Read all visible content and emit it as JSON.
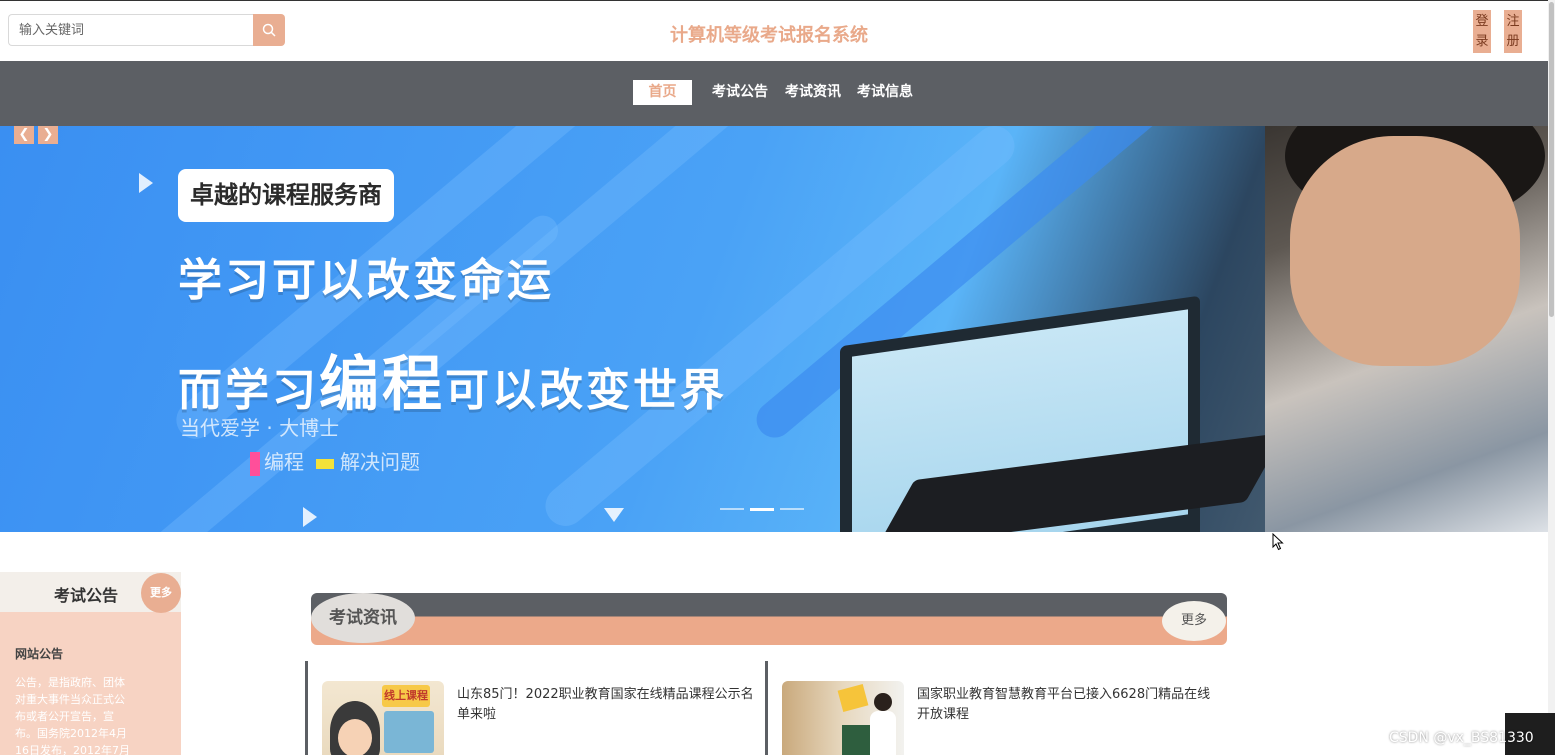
{
  "header": {
    "search_placeholder": "输入关键词",
    "title": "计算机等级考试报名系统",
    "login_label": "登录",
    "register_label": "注册"
  },
  "nav": {
    "items": [
      "首页",
      "考试公告",
      "考试资讯",
      "考试信息"
    ],
    "active_index": 0
  },
  "banner": {
    "badge": "卓越的课程服务商",
    "headline1": "学习可以改变命运",
    "headline2_pre": "而学习",
    "headline2_big": "编程",
    "headline2_post": "可以改变世界",
    "subtitle": "当代爱学 · 大博士",
    "tag1": "编程",
    "tag2": "解决问题",
    "prev_icon": "chevron-left-icon",
    "next_icon": "chevron-right-icon",
    "slide_count": 3,
    "active_slide": 1
  },
  "notice": {
    "title": "考试公告",
    "more_label": "更多",
    "item_title": "网站公告",
    "item_text": "公告，是指政府、团体对重大事件当众正式公布或者公开宣告，宣布。国务院2012年4月16日发布，2012年7月1"
  },
  "news": {
    "title": "考试资讯",
    "more_label": "更多",
    "items": [
      {
        "text": "山东85门！2022职业教育国家在线精品课程公示名单来啦",
        "thumb_label": "线上课程"
      },
      {
        "text": "国家职业教育智慧教育平台已接入6628门精品在线开放课程",
        "thumb_label": ""
      }
    ]
  },
  "watermark": "CSDN @vx_BS81330",
  "colors": {
    "accent": "#e9ae92",
    "nav_bg": "#5c5f64",
    "title": "#e9a98a"
  }
}
